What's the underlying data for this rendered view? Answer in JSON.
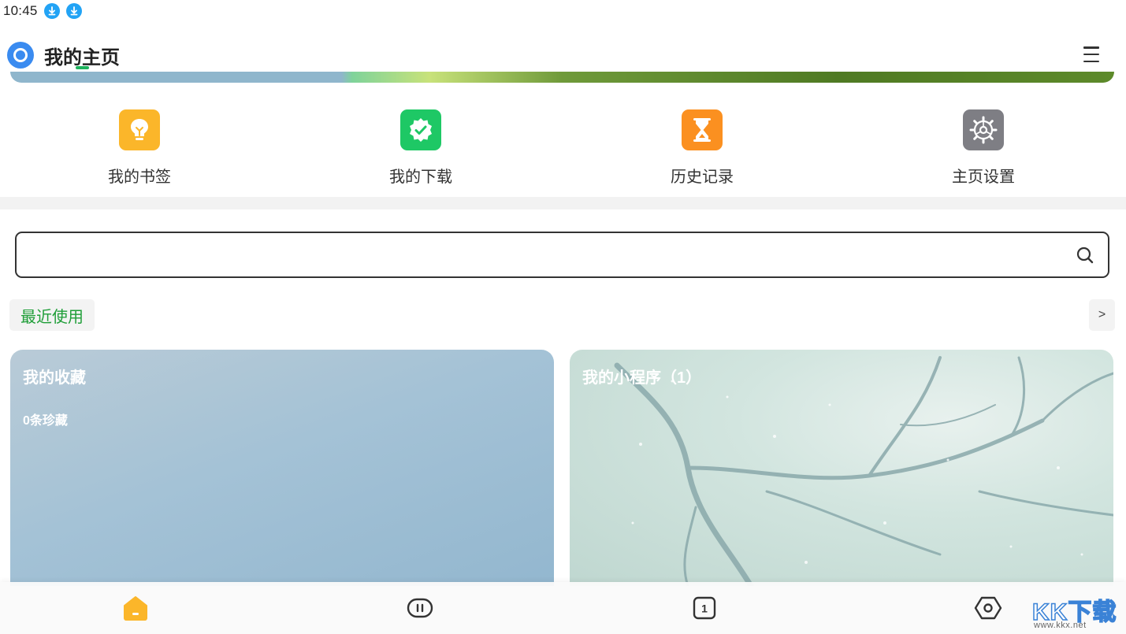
{
  "status_bar": {
    "time": "10:45",
    "icons": [
      "download-icon",
      "download-icon"
    ]
  },
  "header": {
    "title": "我的主页",
    "menu_icon": "hamburger-menu-icon"
  },
  "quick_actions": [
    {
      "label": "我的书签",
      "icon": "lightbulb-icon",
      "color": "#fbb62a"
    },
    {
      "label": "我的下载",
      "icon": "badge-check-icon",
      "color": "#1ec865"
    },
    {
      "label": "历史记录",
      "icon": "hourglass-icon",
      "color": "#fb9020"
    },
    {
      "label": "主页设置",
      "icon": "gear-icon",
      "color": "#7e7e84"
    }
  ],
  "search": {
    "value": "",
    "placeholder": ""
  },
  "recent": {
    "label": "最近使用",
    "more_label": ">"
  },
  "cards": [
    {
      "title": "我的收藏",
      "subtitle": "0条珍藏"
    },
    {
      "title": "我的小程序（1）"
    }
  ],
  "bottom_nav": [
    {
      "icon": "home-icon",
      "active": true
    },
    {
      "icon": "mini-program-icon"
    },
    {
      "icon": "tabs-count-icon",
      "badge": "1"
    },
    {
      "icon": "settings-hex-icon"
    }
  ],
  "watermark": {
    "text": "KK下载",
    "url": "www.kkx.net"
  },
  "colors": {
    "accent": "#1db35c",
    "recent_text": "#1f9e38",
    "home_active": "#fbb62a"
  }
}
